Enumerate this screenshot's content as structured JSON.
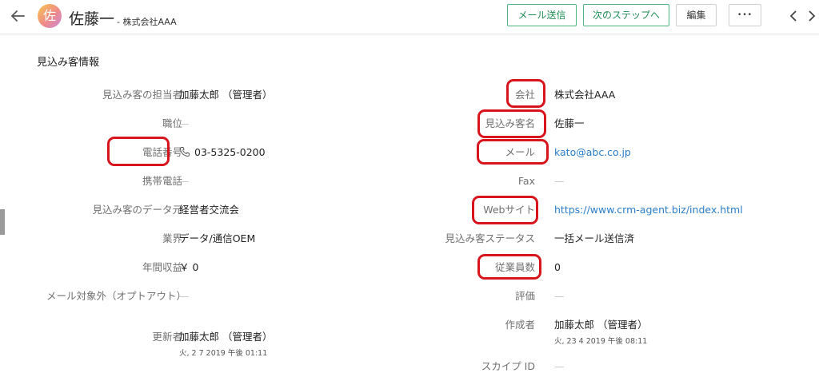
{
  "header": {
    "avatar_char": "佐",
    "lead_name": "佐藤一",
    "company": "株式会社AAA",
    "buttons": {
      "send_mail": "メール送信",
      "next_step": "次のステップへ",
      "edit": "編集",
      "more": "•••"
    }
  },
  "section_title": "見込み客情報",
  "left_fields": [
    {
      "label": "見込み客の担当者",
      "value": "加藤太郎 （管理者）"
    },
    {
      "label": "職位",
      "value": "—"
    },
    {
      "label": "電話番号",
      "value": "03-5325-0200"
    },
    {
      "label": "携帯電話",
      "value": "—"
    },
    {
      "label": "見込み客のデータ元",
      "value": "経営者交流会"
    },
    {
      "label": "業界",
      "value": "データ/通信OEM"
    },
    {
      "label": "年間収益",
      "value": "￥ 0"
    },
    {
      "label": "メール対象外（オプトアウト）",
      "value": "—"
    },
    {
      "label": "更新者",
      "value": "加藤太郎 （管理者）",
      "sub": "火, 2 7 2019 午後 01:11"
    }
  ],
  "right_fields": [
    {
      "label": "会社",
      "value": "株式会社AAA"
    },
    {
      "label": "見込み客名",
      "value": "佐藤一"
    },
    {
      "label": "メール",
      "value": "kato@abc.co.jp"
    },
    {
      "label": "Fax",
      "value": "—"
    },
    {
      "label": "Webサイト",
      "value": "https://www.crm-agent.biz/index.html"
    },
    {
      "label": "見込み客ステータス",
      "value": "一括メール送信済"
    },
    {
      "label": "従業員数",
      "value": "0"
    },
    {
      "label": "評価",
      "value": "—"
    },
    {
      "label": "作成者",
      "value": "加藤太郎 （管理者）",
      "sub": "火, 23 4 2019 午後 08:11"
    },
    {
      "label": "スカイプ ID",
      "value": "—"
    }
  ],
  "colors": {
    "highlight": "#d8141d",
    "accent_green": "#4db57f",
    "link": "#2b7dc8"
  }
}
